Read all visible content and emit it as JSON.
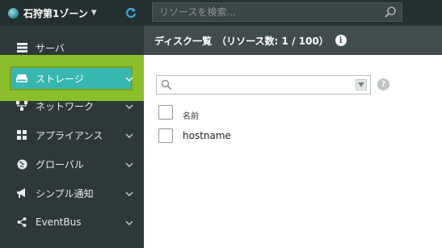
{
  "topbar": {
    "zone_label": "石狩第1ゾーン",
    "zone_caret": "▼",
    "search_placeholder": "リソースを検索..."
  },
  "sidebar": {
    "items": [
      {
        "label": "サーバ",
        "icon": "server-icon",
        "active": false
      },
      {
        "label": "ストレージ",
        "icon": "storage-icon",
        "active": true
      },
      {
        "label": "ネットワーク",
        "icon": "network-icon",
        "active": false
      },
      {
        "label": "アプライアンス",
        "icon": "appliance-icon",
        "active": false
      },
      {
        "label": "グローバル",
        "icon": "globe-icon",
        "active": false
      },
      {
        "label": "シンプル通知",
        "icon": "megaphone-icon",
        "active": false
      },
      {
        "label": "EventBus",
        "icon": "share-icon",
        "active": false
      }
    ]
  },
  "main": {
    "title": "ディスク一覧　（リソース数: 1 / 100）",
    "filter_value": "",
    "table": {
      "column_header": "名前",
      "rows": [
        {
          "name": "hostname"
        }
      ]
    }
  },
  "colors": {
    "topbar_bg": "#243030",
    "sidebar_bg": "#2d3939",
    "header_bg": "#414c4c",
    "highlight": "#8bbe2c",
    "active_item": "#38b6b0",
    "refresh_accent": "#3fa9e0"
  }
}
